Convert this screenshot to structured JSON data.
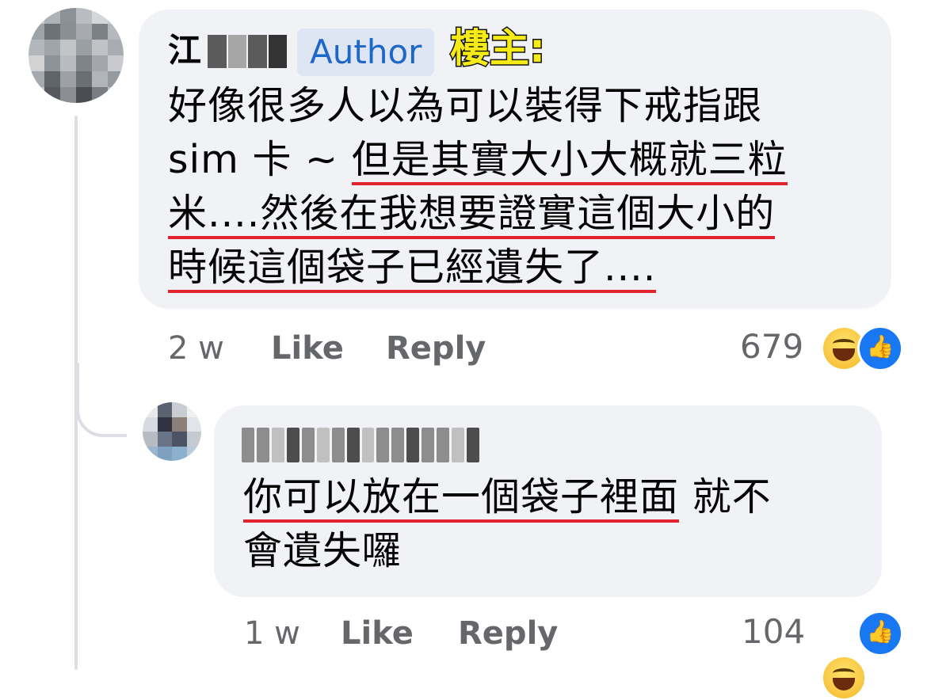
{
  "comment": {
    "author_initial": "江",
    "author_badge": "Author",
    "op_label": "樓主:",
    "lines": [
      {
        "plain": "好像很多人以為可以裝得下戒指跟",
        "underlined": ""
      },
      {
        "plain": "sim 卡 ~ ",
        "underlined": "但是其實大小大概就三粒"
      },
      {
        "plain": "",
        "underlined": "米....然後在我想要證實這個大小的"
      },
      {
        "plain": "",
        "underlined": "時候這個袋子已經遺失了...."
      }
    ],
    "time": "2 w",
    "like_label": "Like",
    "reply_label": "Reply",
    "reaction_count": "679",
    "reaction_icons": [
      "haha-icon",
      "like-icon"
    ]
  },
  "reply": {
    "lines": [
      {
        "underlined": "你可以放在一個袋子裡面",
        "plain": " 就不"
      },
      {
        "underlined": "",
        "plain": "會遺失囉"
      }
    ],
    "time": "1 w",
    "like_label": "Like",
    "reply_label": "Reply",
    "reaction_count": "104",
    "reaction_icons": [
      "haha-icon",
      "like-icon"
    ]
  },
  "colors": {
    "bubble": "#f0f2f5",
    "badge_bg": "#dfe6f3",
    "badge_text": "#1d67c9",
    "underline": "#e0232f",
    "meta_text": "#65676b",
    "op_label": "#f7eb17"
  }
}
